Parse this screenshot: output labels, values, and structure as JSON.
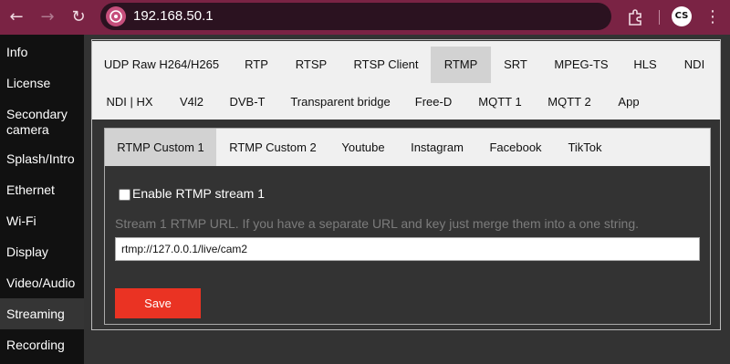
{
  "browser": {
    "url": "192.168.50.1",
    "back_icon": "←",
    "forward_icon": "→",
    "reload_icon": "↻",
    "profile_initials": "CS",
    "menu_icon": "⋮"
  },
  "sidebar": {
    "items": [
      {
        "label": "Info"
      },
      {
        "label": "License"
      },
      {
        "label": "Secondary camera"
      },
      {
        "label": "Splash/Intro"
      },
      {
        "label": "Ethernet"
      },
      {
        "label": "Wi-Fi"
      },
      {
        "label": "Display"
      },
      {
        "label": "Video/Audio"
      },
      {
        "label": "Streaming"
      },
      {
        "label": "Recording"
      }
    ]
  },
  "protocol_tabs": [
    {
      "label": "UDP Raw H264/H265"
    },
    {
      "label": "RTP"
    },
    {
      "label": "RTSP"
    },
    {
      "label": "RTSP Client"
    },
    {
      "label": "RTMP"
    },
    {
      "label": "SRT"
    },
    {
      "label": "MPEG-TS"
    },
    {
      "label": "HLS"
    },
    {
      "label": "NDI"
    },
    {
      "label": "NDI | HX"
    },
    {
      "label": "V4l2"
    },
    {
      "label": "DVB-T"
    },
    {
      "label": "Transparent bridge"
    },
    {
      "label": "Free-D"
    },
    {
      "label": "MQTT 1"
    },
    {
      "label": "MQTT 2"
    },
    {
      "label": "App"
    }
  ],
  "rtmp_tabs": [
    {
      "label": "RTMP Custom 1"
    },
    {
      "label": "RTMP Custom 2"
    },
    {
      "label": "Youtube"
    },
    {
      "label": "Instagram"
    },
    {
      "label": "Facebook"
    },
    {
      "label": "TikTok"
    }
  ],
  "form": {
    "enable_label": "Enable RTMP stream 1",
    "hint": "Stream 1 RTMP URL. If you have a separate URL and key just merge them into a one string.",
    "url_value": "rtmp://127.0.0.1/live/cam2",
    "save_label": "Save"
  },
  "colors": {
    "chrome": "#7a2344",
    "accent": "#ea3323"
  }
}
